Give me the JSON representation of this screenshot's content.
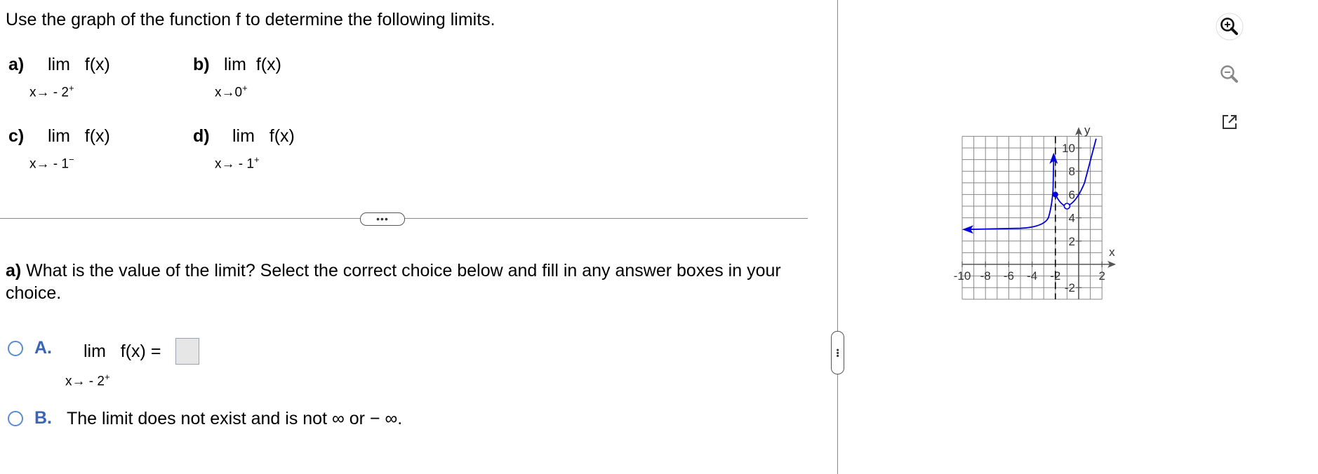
{
  "instruction": "Use the graph of the function f to determine the following limits.",
  "parts": [
    {
      "label": "a)",
      "lim": "lim",
      "func": "f(x)",
      "approach": "x→ - 2",
      "side": "+"
    },
    {
      "label": "b)",
      "lim": "lim",
      "func": "f(x)",
      "approach": "x→0",
      "side": "+"
    },
    {
      "label": "c)",
      "lim": "lim",
      "func": "f(x)",
      "approach": "x→ - 1",
      "side": "−"
    },
    {
      "label": "d)",
      "lim": "lim",
      "func": "f(x)",
      "approach": "x→ - 1",
      "side": "+"
    }
  ],
  "divider_dots": "•••",
  "vertical_divider_dots": "•••",
  "question": {
    "label": "a)",
    "text": " What is the value of the limit? Select the correct choice below and fill in any answer boxes in your choice."
  },
  "choices": {
    "a": {
      "label": "A.",
      "lim": "lim",
      "expr": "f(x) =",
      "approach": "x→ - 2",
      "side": "+",
      "answer_value": ""
    },
    "b": {
      "label": "B.",
      "text": "The limit does not exist and is not ∞ or  − ∞."
    }
  },
  "graph": {
    "x_axis_label": "x",
    "y_axis_label": "y",
    "x_ticks": [
      "-10",
      "-8",
      "-6",
      "-4",
      "-2",
      "2"
    ],
    "y_ticks": [
      "10",
      "8",
      "6",
      "4",
      "2",
      "-2"
    ],
    "curve_color": "#0000dd",
    "asymptote_x": -2,
    "closed_point": [
      -2,
      6
    ],
    "open_point": [
      -1,
      5
    ]
  },
  "tools": {
    "zoom_in": "zoom-in-icon",
    "zoom_out": "zoom-out-icon",
    "popout": "popout-icon"
  }
}
